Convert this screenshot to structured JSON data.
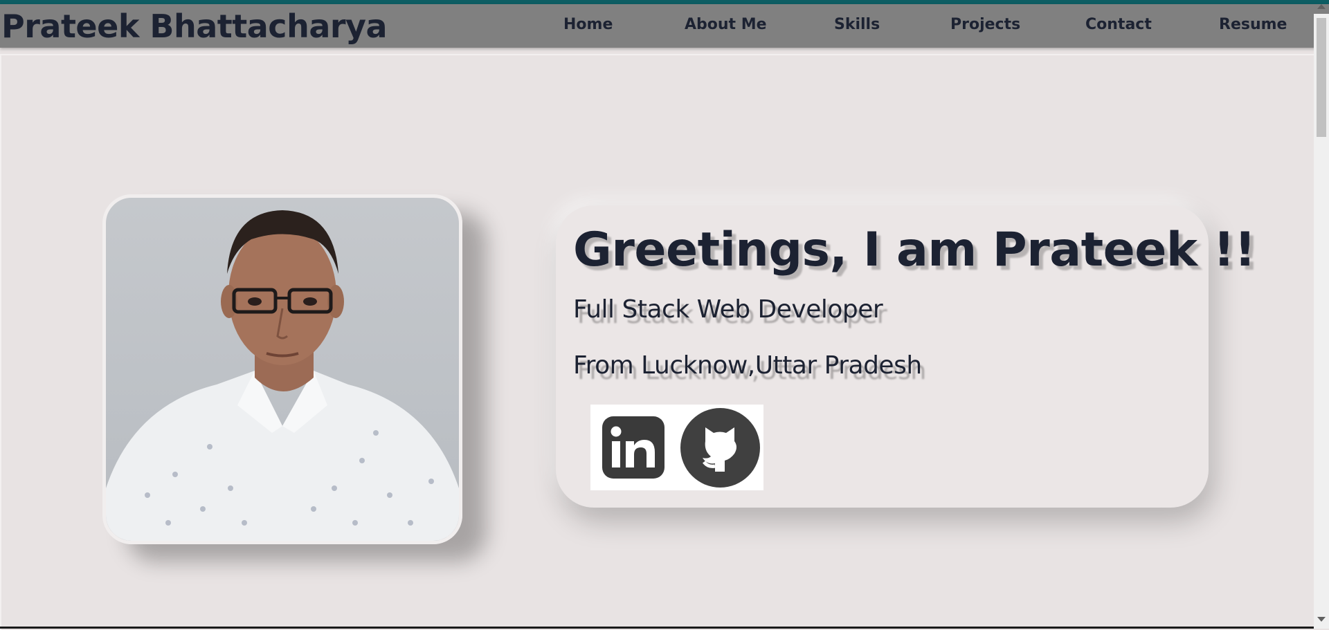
{
  "header": {
    "brand": "Prateek Bhattacharya",
    "nav": [
      {
        "label": "Home"
      },
      {
        "label": "About Me"
      },
      {
        "label": "Skills"
      },
      {
        "label": "Projects"
      },
      {
        "label": "Contact"
      },
      {
        "label": "Resume"
      }
    ]
  },
  "hero": {
    "greeting": "Greetings, I am Prateek !!",
    "role": "Full Stack Web Developer",
    "location": "From Lucknow,Uttar Pradesh",
    "social": [
      {
        "icon": "linkedin-icon"
      },
      {
        "icon": "github-icon"
      }
    ]
  },
  "colors": {
    "accent": "#0d5d63",
    "navbar": "#808080",
    "text": "#1c2232",
    "background": "#e8e3e3"
  }
}
